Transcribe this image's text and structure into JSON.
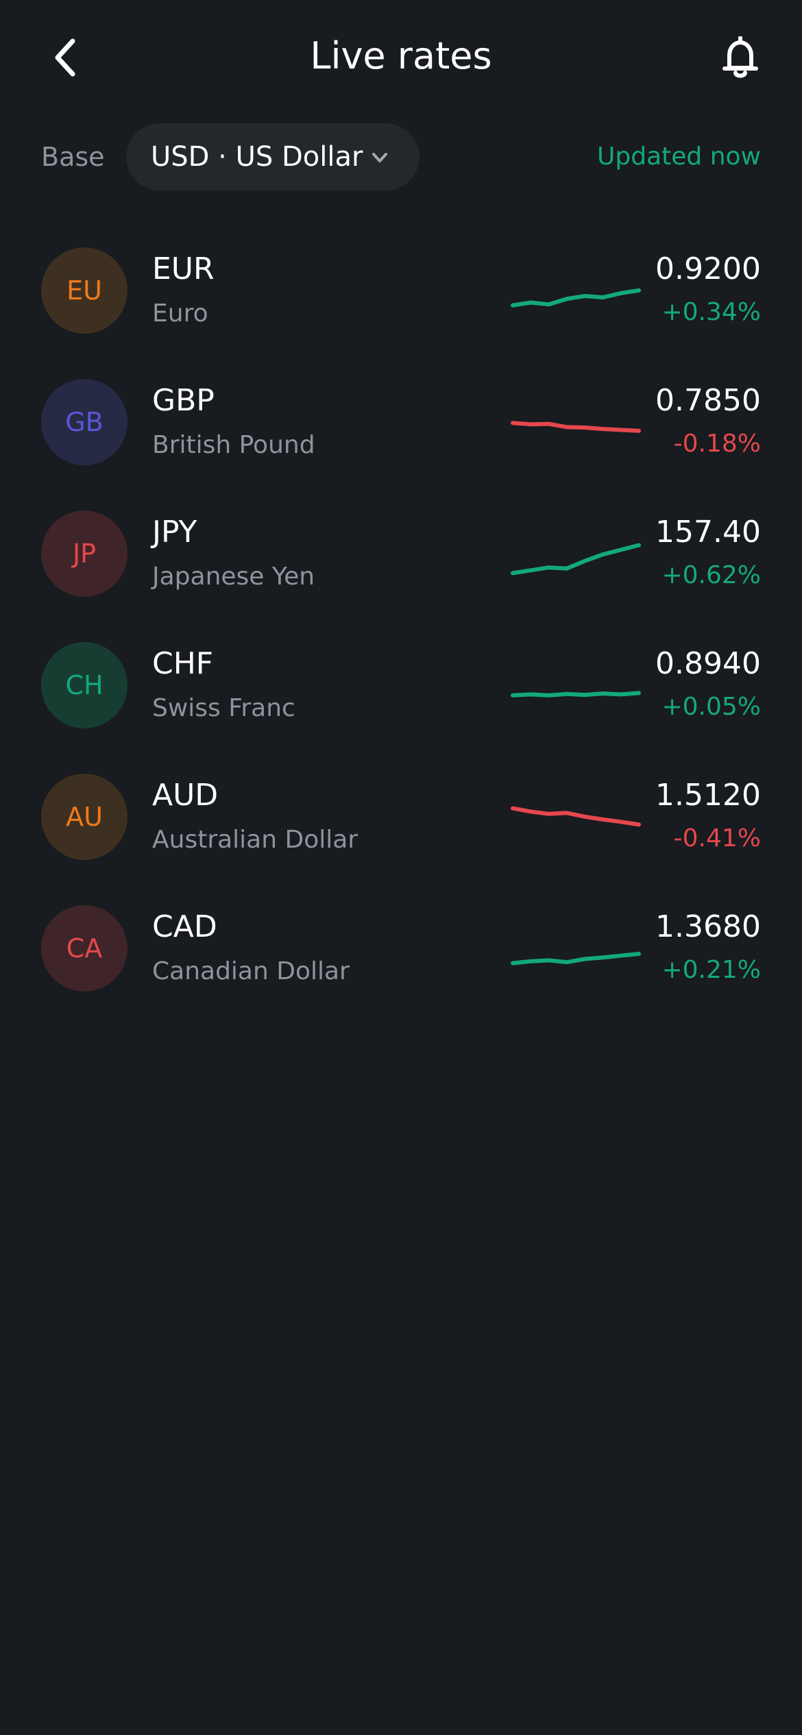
{
  "header": {
    "title": "Live rates",
    "back_icon": "chevron-left-icon",
    "bell_icon": "bell-icon"
  },
  "base": {
    "label": "Base",
    "selected": "USD · US Dollar",
    "dropdown_icon": "chevron-down-icon",
    "updated": "Updated now"
  },
  "colors": {
    "positive": "#13a97a",
    "negative": "#e5484d",
    "background": "#181b1f"
  },
  "rates": [
    {
      "badge": "EU",
      "code": "EUR",
      "name": "Euro",
      "rate": "0.9200",
      "change": "+0.34%",
      "direction": "up",
      "badge_fg": "#f07a1a",
      "badge_bg": "#3e3020",
      "trend": [
        3.0,
        3.6,
        3.2,
        4.4,
        5.0,
        4.7,
        5.6,
        6.2
      ]
    },
    {
      "badge": "GB",
      "code": "GBP",
      "name": "British Pound",
      "rate": "0.7850",
      "change": "-0.18%",
      "direction": "down",
      "badge_fg": "#5856d6",
      "badge_bg": "#272a45",
      "trend": [
        6.0,
        5.7,
        5.8,
        5.1,
        5.0,
        4.7,
        4.5,
        4.3
      ]
    },
    {
      "badge": "JP",
      "code": "JPY",
      "name": "Japanese Yen",
      "rate": "157.40",
      "change": "+0.62%",
      "direction": "up",
      "badge_fg": "#e5484d",
      "badge_bg": "#3f2529",
      "trend": [
        2.0,
        2.6,
        3.2,
        3.0,
        4.6,
        6.0,
        7.0,
        8.0
      ]
    },
    {
      "badge": "CH",
      "code": "CHF",
      "name": "Swiss Franc",
      "rate": "0.8940",
      "change": "+0.05%",
      "direction": "up",
      "badge_fg": "#13a97a",
      "badge_bg": "#173d32",
      "trend": [
        4.0,
        4.2,
        4.0,
        4.3,
        4.1,
        4.4,
        4.2,
        4.5
      ]
    },
    {
      "badge": "AU",
      "code": "AUD",
      "name": "Australian Dollar",
      "rate": "1.5120",
      "change": "-0.41%",
      "direction": "down",
      "badge_fg": "#f07a1a",
      "badge_bg": "#3e3020",
      "trend": [
        8.0,
        7.3,
        6.8,
        7.0,
        6.2,
        5.6,
        5.1,
        4.5
      ]
    },
    {
      "badge": "CA",
      "code": "CAD",
      "name": "Canadian Dollar",
      "rate": "1.3680",
      "change": "+0.21%",
      "direction": "up",
      "badge_fg": "#e5484d",
      "badge_bg": "#3f2529",
      "trend": [
        3.0,
        3.4,
        3.6,
        3.2,
        3.9,
        4.2,
        4.6,
        5.0
      ]
    }
  ]
}
